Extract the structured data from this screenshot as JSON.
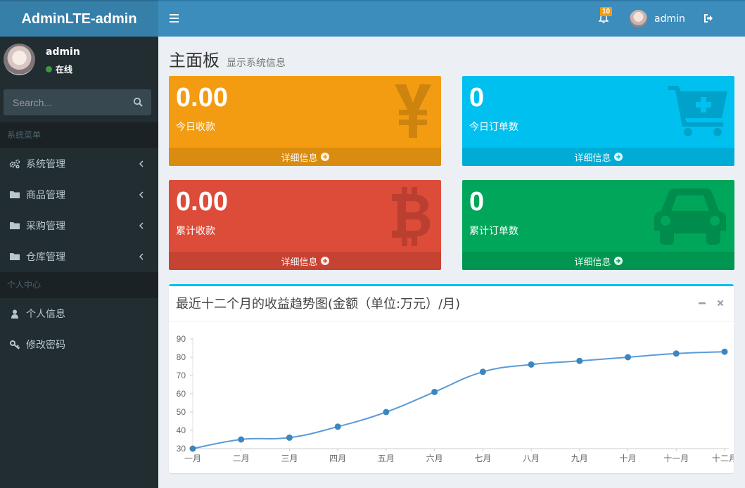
{
  "header": {
    "logo": "AdminLTE-admin",
    "notifications_count": "10",
    "user_name": "admin"
  },
  "sidebar": {
    "user_name": "admin",
    "status": "在线",
    "search_placeholder": "Search...",
    "section_system": "系统菜单",
    "items": [
      {
        "label": "系统管理",
        "icon": "gears-icon"
      },
      {
        "label": "商品管理",
        "icon": "folder-icon"
      },
      {
        "label": "采购管理",
        "icon": "folder-icon"
      },
      {
        "label": "仓库管理",
        "icon": "folder-icon"
      }
    ],
    "section_personal": "个人中心",
    "personal_items": [
      {
        "label": "个人信息",
        "icon": "user-icon"
      },
      {
        "label": "修改密码",
        "icon": "key-icon"
      }
    ]
  },
  "page": {
    "title": "主面板",
    "subtitle": "显示系统信息"
  },
  "boxes": [
    {
      "value": "0.00",
      "label": "今日收款",
      "footer": "详细信息",
      "color": "#f39c12",
      "icon": "yen-icon"
    },
    {
      "value": "0",
      "label": "今日订单数",
      "footer": "详细信息",
      "color": "#00c0ef",
      "icon": "cart-plus-icon"
    },
    {
      "value": "0.00",
      "label": "累计收款",
      "footer": "详细信息",
      "color": "#dd4b39",
      "icon": "bitcoin-icon"
    },
    {
      "value": "0",
      "label": "累计订单数",
      "footer": "详细信息",
      "color": "#00a65a",
      "icon": "car-icon"
    }
  ],
  "chart_box": {
    "title": "最近十二个月的收益趋势图(金额（单位:万元）/月)"
  },
  "chart_data": {
    "type": "line",
    "categories": [
      "一月",
      "二月",
      "三月",
      "四月",
      "五月",
      "六月",
      "七月",
      "八月",
      "九月",
      "十月",
      "十一月",
      "十二月"
    ],
    "series": [
      {
        "values": [
          30,
          35,
          36,
          42,
          50,
          61,
          72,
          76,
          78,
          80,
          82,
          83
        ]
      }
    ],
    "ylim": [
      30,
      90
    ],
    "yticks": [
      30,
      40,
      50,
      60,
      70,
      80,
      90
    ],
    "line_color": "#5b9bd5",
    "point_color": "#3c86bf",
    "smooth": true
  }
}
